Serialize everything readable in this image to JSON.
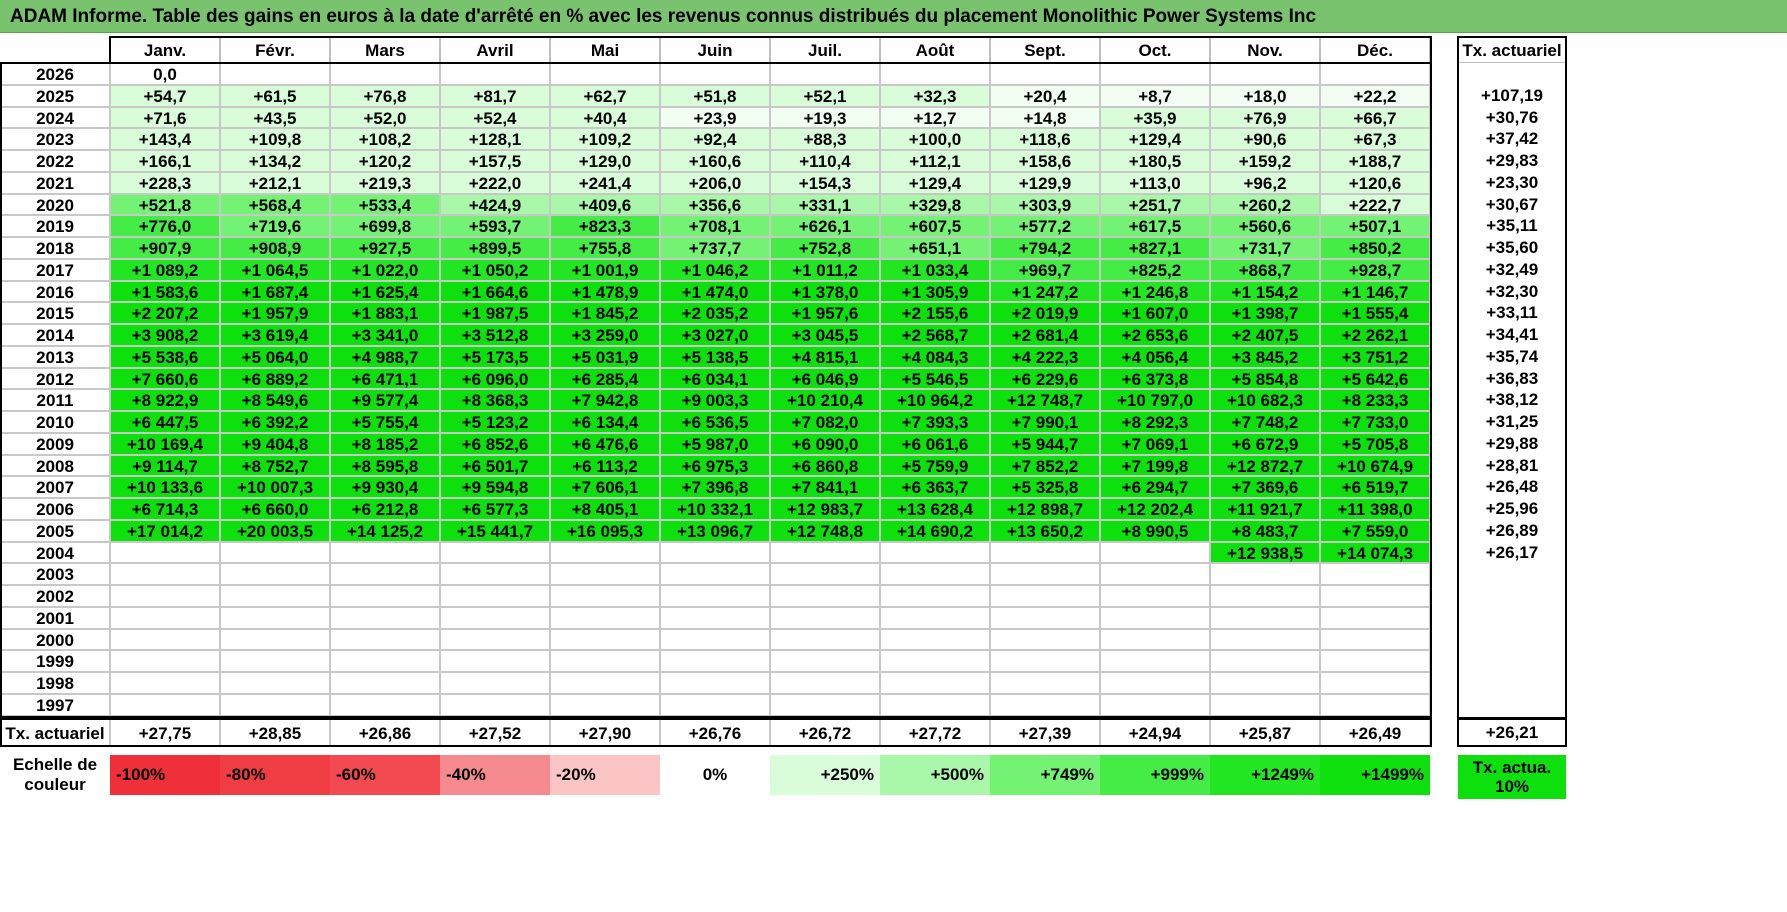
{
  "title": "ADAM Informe. Table des gains en euros à la date d'arrêté en % avec les revenus connus distribués du placement Monolithic Power Systems Inc",
  "months": [
    "Janv.",
    "Févr.",
    "Mars",
    "Avril",
    "Mai",
    "Juin",
    "Juil.",
    "Août",
    "Sept.",
    "Oct.",
    "Nov.",
    "Déc."
  ],
  "right_header": "Tx. actuariel",
  "rows": [
    {
      "year": "2026",
      "values": [
        "0,0",
        "",
        "",
        "",
        "",
        "",
        "",
        "",
        "",
        "",
        "",
        ""
      ],
      "rate": ""
    },
    {
      "year": "2025",
      "values": [
        "+54,7",
        "+61,5",
        "+76,8",
        "+81,7",
        "+62,7",
        "+51,8",
        "+52,1",
        "+32,3",
        "+20,4",
        "+8,7",
        "+18,0",
        "+22,2"
      ],
      "rate": "+107,19"
    },
    {
      "year": "2024",
      "values": [
        "+71,6",
        "+43,5",
        "+52,0",
        "+52,4",
        "+40,4",
        "+23,9",
        "+19,3",
        "+12,7",
        "+14,8",
        "+35,9",
        "+76,9",
        "+66,7"
      ],
      "rate": "+30,76"
    },
    {
      "year": "2023",
      "values": [
        "+143,4",
        "+109,8",
        "+108,2",
        "+128,1",
        "+109,2",
        "+92,4",
        "+88,3",
        "+100,0",
        "+118,6",
        "+129,4",
        "+90,6",
        "+67,3"
      ],
      "rate": "+37,42"
    },
    {
      "year": "2022",
      "values": [
        "+166,1",
        "+134,2",
        "+120,2",
        "+157,5",
        "+129,0",
        "+160,6",
        "+110,4",
        "+112,1",
        "+158,6",
        "+180,5",
        "+159,2",
        "+188,7"
      ],
      "rate": "+29,83"
    },
    {
      "year": "2021",
      "values": [
        "+228,3",
        "+212,1",
        "+219,3",
        "+222,0",
        "+241,4",
        "+206,0",
        "+154,3",
        "+129,4",
        "+129,9",
        "+113,0",
        "+96,2",
        "+120,6"
      ],
      "rate": "+23,30"
    },
    {
      "year": "2020",
      "values": [
        "+521,8",
        "+568,4",
        "+533,4",
        "+424,9",
        "+409,6",
        "+356,6",
        "+331,1",
        "+329,8",
        "+303,9",
        "+251,7",
        "+260,2",
        "+222,7"
      ],
      "rate": "+30,67"
    },
    {
      "year": "2019",
      "values": [
        "+776,0",
        "+719,6",
        "+699,8",
        "+593,7",
        "+823,3",
        "+708,1",
        "+626,1",
        "+607,5",
        "+577,2",
        "+617,5",
        "+560,6",
        "+507,1"
      ],
      "rate": "+35,11"
    },
    {
      "year": "2018",
      "values": [
        "+907,9",
        "+908,9",
        "+927,5",
        "+899,5",
        "+755,8",
        "+737,7",
        "+752,8",
        "+651,1",
        "+794,2",
        "+827,1",
        "+731,7",
        "+850,2"
      ],
      "rate": "+35,60"
    },
    {
      "year": "2017",
      "values": [
        "+1 089,2",
        "+1 064,5",
        "+1 022,0",
        "+1 050,2",
        "+1 001,9",
        "+1 046,2",
        "+1 011,2",
        "+1 033,4",
        "+969,7",
        "+825,2",
        "+868,7",
        "+928,7"
      ],
      "rate": "+32,49"
    },
    {
      "year": "2016",
      "values": [
        "+1 583,6",
        "+1 687,4",
        "+1 625,4",
        "+1 664,6",
        "+1 478,9",
        "+1 474,0",
        "+1 378,0",
        "+1 305,9",
        "+1 247,2",
        "+1 246,8",
        "+1 154,2",
        "+1 146,7"
      ],
      "rate": "+32,30"
    },
    {
      "year": "2015",
      "values": [
        "+2 207,2",
        "+1 957,9",
        "+1 883,1",
        "+1 987,5",
        "+1 845,2",
        "+2 035,2",
        "+1 957,6",
        "+2 155,6",
        "+2 019,9",
        "+1 607,0",
        "+1 398,7",
        "+1 555,4"
      ],
      "rate": "+33,11"
    },
    {
      "year": "2014",
      "values": [
        "+3 908,2",
        "+3 619,4",
        "+3 341,0",
        "+3 512,8",
        "+3 259,0",
        "+3 027,0",
        "+3 045,5",
        "+2 568,7",
        "+2 681,4",
        "+2 653,6",
        "+2 407,5",
        "+2 262,1"
      ],
      "rate": "+34,41"
    },
    {
      "year": "2013",
      "values": [
        "+5 538,6",
        "+5 064,0",
        "+4 988,7",
        "+5 173,5",
        "+5 031,9",
        "+5 138,5",
        "+4 815,1",
        "+4 084,3",
        "+4 222,3",
        "+4 056,4",
        "+3 845,2",
        "+3 751,2"
      ],
      "rate": "+35,74"
    },
    {
      "year": "2012",
      "values": [
        "+7 660,6",
        "+6 889,2",
        "+6 471,1",
        "+6 096,0",
        "+6 285,4",
        "+6 034,1",
        "+6 046,9",
        "+5 546,5",
        "+6 229,6",
        "+6 373,8",
        "+5 854,8",
        "+5 642,6"
      ],
      "rate": "+36,83"
    },
    {
      "year": "2011",
      "values": [
        "+8 922,9",
        "+8 549,6",
        "+9 577,4",
        "+8 368,3",
        "+7 942,8",
        "+9 003,3",
        "+10 210,4",
        "+10 964,2",
        "+12 748,7",
        "+10 797,0",
        "+10 682,3",
        "+8 233,3"
      ],
      "rate": "+38,12"
    },
    {
      "year": "2010",
      "values": [
        "+6 447,5",
        "+6 392,2",
        "+5 755,4",
        "+5 123,2",
        "+6 134,4",
        "+6 536,5",
        "+7 082,0",
        "+7 393,3",
        "+7 990,1",
        "+8 292,3",
        "+7 748,2",
        "+7 733,0"
      ],
      "rate": "+31,25"
    },
    {
      "year": "2009",
      "values": [
        "+10 169,4",
        "+9 404,8",
        "+8 185,2",
        "+6 852,6",
        "+6 476,6",
        "+5 987,0",
        "+6 090,0",
        "+6 061,6",
        "+5 944,7",
        "+7 069,1",
        "+6 672,9",
        "+5 705,8"
      ],
      "rate": "+29,88"
    },
    {
      "year": "2008",
      "values": [
        "+9 114,7",
        "+8 752,7",
        "+8 595,8",
        "+6 501,7",
        "+6 113,2",
        "+6 975,3",
        "+6 860,8",
        "+5 759,9",
        "+7 852,2",
        "+7 199,8",
        "+12 872,7",
        "+10 674,9"
      ],
      "rate": "+28,81"
    },
    {
      "year": "2007",
      "values": [
        "+10 133,6",
        "+10 007,3",
        "+9 930,4",
        "+9 594,8",
        "+7 606,1",
        "+7 396,8",
        "+7 841,1",
        "+6 363,7",
        "+5 325,8",
        "+6 294,7",
        "+7 369,6",
        "+6 519,7"
      ],
      "rate": "+26,48"
    },
    {
      "year": "2006",
      "values": [
        "+6 714,3",
        "+6 660,0",
        "+6 212,8",
        "+6 577,3",
        "+8 405,1",
        "+10 332,1",
        "+12 983,7",
        "+13 628,4",
        "+12 898,7",
        "+12 202,4",
        "+11 921,7",
        "+11 398,0"
      ],
      "rate": "+25,96"
    },
    {
      "year": "2005",
      "values": [
        "+17 014,2",
        "+20 003,5",
        "+14 125,2",
        "+15 441,7",
        "+16 095,3",
        "+13 096,7",
        "+12 748,8",
        "+14 690,2",
        "+13 650,2",
        "+8 990,5",
        "+8 483,7",
        "+7 559,0"
      ],
      "rate": "+26,89"
    },
    {
      "year": "2004",
      "values": [
        "",
        "",
        "",
        "",
        "",
        "",
        "",
        "",
        "",
        "",
        "+12 938,5",
        "+14 074,3"
      ],
      "rate": "+26,17"
    },
    {
      "year": "2003",
      "values": [
        "",
        "",
        "",
        "",
        "",
        "",
        "",
        "",
        "",
        "",
        "",
        ""
      ],
      "rate": ""
    },
    {
      "year": "2002",
      "values": [
        "",
        "",
        "",
        "",
        "",
        "",
        "",
        "",
        "",
        "",
        "",
        ""
      ],
      "rate": ""
    },
    {
      "year": "2001",
      "values": [
        "",
        "",
        "",
        "",
        "",
        "",
        "",
        "",
        "",
        "",
        "",
        ""
      ],
      "rate": ""
    },
    {
      "year": "2000",
      "values": [
        "",
        "",
        "",
        "",
        "",
        "",
        "",
        "",
        "",
        "",
        "",
        ""
      ],
      "rate": ""
    },
    {
      "year": "1999",
      "values": [
        "",
        "",
        "",
        "",
        "",
        "",
        "",
        "",
        "",
        "",
        "",
        ""
      ],
      "rate": ""
    },
    {
      "year": "1998",
      "values": [
        "",
        "",
        "",
        "",
        "",
        "",
        "",
        "",
        "",
        "",
        "",
        ""
      ],
      "rate": ""
    },
    {
      "year": "1997",
      "values": [
        "",
        "",
        "",
        "",
        "",
        "",
        "",
        "",
        "",
        "",
        "",
        ""
      ],
      "rate": ""
    }
  ],
  "footer": {
    "label": "Tx. actuariel",
    "values": [
      "+27,75",
      "+28,85",
      "+26,86",
      "+27,52",
      "+27,90",
      "+26,76",
      "+26,72",
      "+27,72",
      "+27,39",
      "+24,94",
      "+25,87",
      "+26,49"
    ],
    "total": "+26,21"
  },
  "scale": {
    "label": "Echelle de couleur",
    "items": [
      {
        "text": "-100%",
        "color": "#ef3038",
        "align": "left"
      },
      {
        "text": "-80%",
        "color": "#f03c43",
        "align": "left"
      },
      {
        "text": "-60%",
        "color": "#f24a50",
        "align": "left"
      },
      {
        "text": "-40%",
        "color": "#f58b8e",
        "align": "left"
      },
      {
        "text": "-20%",
        "color": "#fbc5c6",
        "align": "left"
      },
      {
        "text": "0%",
        "color": "#ffffff",
        "align": "center"
      },
      {
        "text": "+250%",
        "color": "#d9fcd9",
        "align": "right"
      },
      {
        "text": "+500%",
        "color": "#a9f7a9",
        "align": "right"
      },
      {
        "text": "+749%",
        "color": "#74f274",
        "align": "right"
      },
      {
        "text": "+999%",
        "color": "#45ec45",
        "align": "right"
      },
      {
        "text": "+1249%",
        "color": "#22e622",
        "align": "right"
      },
      {
        "text": "+1499%",
        "color": "#0ee00e",
        "align": "right"
      }
    ],
    "rate_label": "Tx. actua. 10%",
    "rate_color": "#0ee00e"
  },
  "colors": {
    "title_bg": "#79c36f",
    "green_scale": [
      "#ffffff",
      "#d9fcd9",
      "#a9f7a9",
      "#74f274",
      "#45ec45",
      "#22e622",
      "#0ee00e"
    ]
  }
}
